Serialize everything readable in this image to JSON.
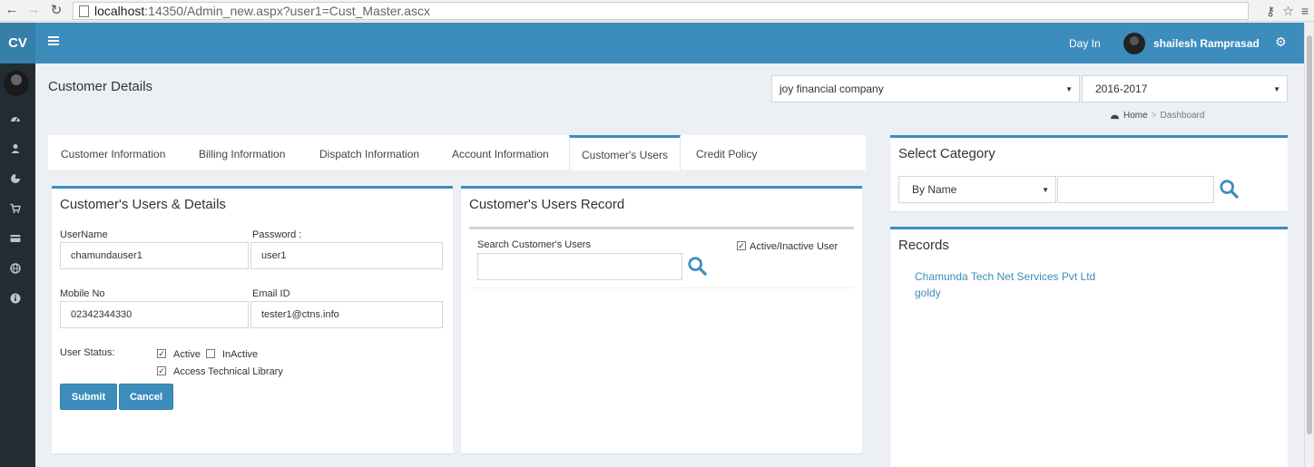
{
  "browser": {
    "url_host": "localhost",
    "url_path": ":14350/Admin_new.aspx?user1=Cust_Master.ascx"
  },
  "header": {
    "logo": "CV",
    "day_in": "Day In",
    "user_name": "shailesh Ramprasad"
  },
  "page": {
    "title": "Customer Details",
    "company_select": "joy financial company",
    "year_select": "2016-2017",
    "breadcrumb_home": "Home",
    "breadcrumb_current": "Dashboard"
  },
  "tabs": [
    {
      "label": "Customer Information"
    },
    {
      "label": "Billing Information"
    },
    {
      "label": "Dispatch Information"
    },
    {
      "label": "Account Information"
    },
    {
      "label": "Customer's Users"
    },
    {
      "label": "Credit Policy"
    }
  ],
  "user_form": {
    "title": "Customer's Users & Details",
    "username_label": "UserName",
    "username_value": "chamundauser1",
    "password_label": "Password :",
    "password_value": "user1",
    "mobile_label": "Mobile No",
    "mobile_value": "02342344330",
    "email_label": "Email ID",
    "email_value": "tester1@ctns.info",
    "status_label": "User Status:",
    "active_label": "Active",
    "inactive_label": "InActive",
    "library_label": "Access Technical Library",
    "active_checked": true,
    "inactive_checked": false,
    "library_checked": true,
    "submit_label": "Submit",
    "cancel_label": "Cancel"
  },
  "users_record": {
    "title": "Customer's Users Record",
    "search_label": "Search Customer's Users",
    "search_value": "",
    "active_toggle_label": "Active/Inactive User",
    "active_toggle_checked": true
  },
  "category": {
    "title": "Select Category",
    "select_value": "By Name",
    "search_value": ""
  },
  "records": {
    "title": "Records",
    "items": [
      "Chamunda Tech Net Services Pvt Ltd",
      "goldy"
    ]
  },
  "colors": {
    "primary": "#3c8dbc",
    "sidebar": "#222d32",
    "background": "#ecf0f5"
  }
}
